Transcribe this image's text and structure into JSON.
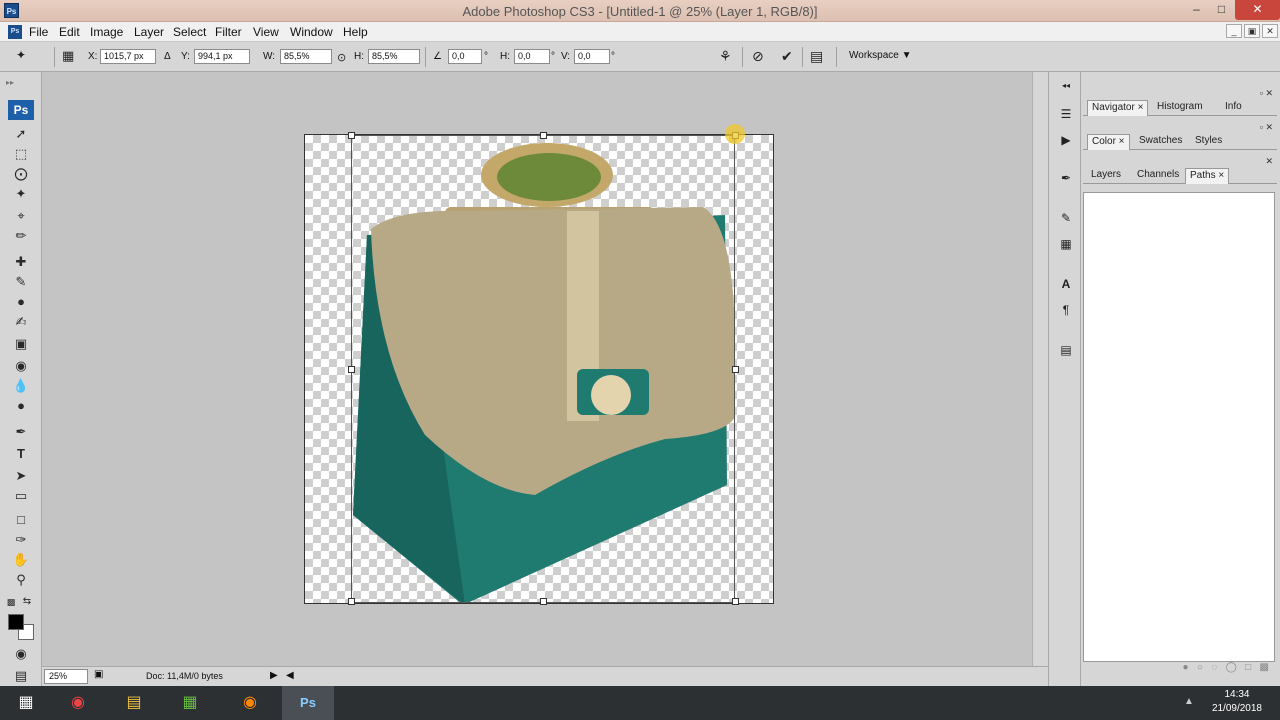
{
  "window": {
    "title": "Adobe Photoshop CS3 - [Untitled-1 @ 25% (Layer 1, RGB/8)]",
    "app_icon_text": "Ps",
    "controls": [
      "–",
      "□",
      "✕"
    ]
  },
  "menu": {
    "items": [
      "File",
      "Edit",
      "Image",
      "Layer",
      "Select",
      "Filter",
      "View",
      "Window",
      "Help"
    ],
    "doc_icon_text": "Ps"
  },
  "options": {
    "x_label": "X:",
    "x_value": "1015,7 px",
    "y_label": "Y:",
    "y_value": "994,1 px",
    "w_label": "W:",
    "w_value": "85,5%",
    "h_label": "H:",
    "h_value": "85,5%",
    "angle_value": "0,0",
    "hskew_label": "H:",
    "hskew_value": "0,0",
    "vskew_label": "V:",
    "vskew_value": "0,0",
    "degree": "°",
    "workspace_label": "Workspace ▼"
  },
  "toolbox": {
    "logo": "Ps"
  },
  "canvas": {
    "image": "handbag-product-photo",
    "bag_colors": {
      "body": "#1f7a70",
      "flap": "#b8a986",
      "ornament": "#d9c7a0"
    }
  },
  "panels": {
    "group1": {
      "tabs": [
        "Navigator",
        "Histogram",
        "Info"
      ],
      "active": "Navigator"
    },
    "group2": {
      "tabs": [
        "Color",
        "Swatches",
        "Styles"
      ],
      "active": "Color"
    },
    "group3": {
      "tabs": [
        "Layers",
        "Channels",
        "Paths"
      ],
      "active": "Paths"
    }
  },
  "status": {
    "zoom": "25%",
    "doc": "Doc: 11,4M/0 bytes"
  },
  "taskbar": {
    "time": "14:34",
    "date": "21/09/2018",
    "apps": [
      "windows-start",
      "chrome",
      "file-explorer",
      "spreadsheet",
      "media",
      "photoshop"
    ]
  }
}
